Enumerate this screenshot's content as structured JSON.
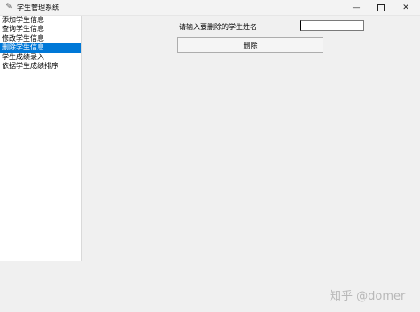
{
  "window": {
    "title": "学生管理系统",
    "icon": "feather-icon",
    "controls": {
      "minimize": "minimize-icon",
      "maximize": "maximize-icon",
      "close": "close-icon"
    }
  },
  "sidebar": {
    "items": [
      {
        "label": "添加学生信息",
        "selected": false
      },
      {
        "label": "查询学生信息",
        "selected": false
      },
      {
        "label": "修改学生信息",
        "selected": false
      },
      {
        "label": "删除学生信息",
        "selected": true
      },
      {
        "label": "学生成绩录入",
        "selected": false
      },
      {
        "label": "依据学生成绩排序",
        "selected": false
      }
    ]
  },
  "main": {
    "prompt_label": "请输入要删除的学生姓名",
    "name_input_value": "",
    "delete_button_label": "删除"
  },
  "watermark": "知乎 @domer",
  "colors": {
    "selection": "#0078d7",
    "background": "#f0f0f0"
  }
}
